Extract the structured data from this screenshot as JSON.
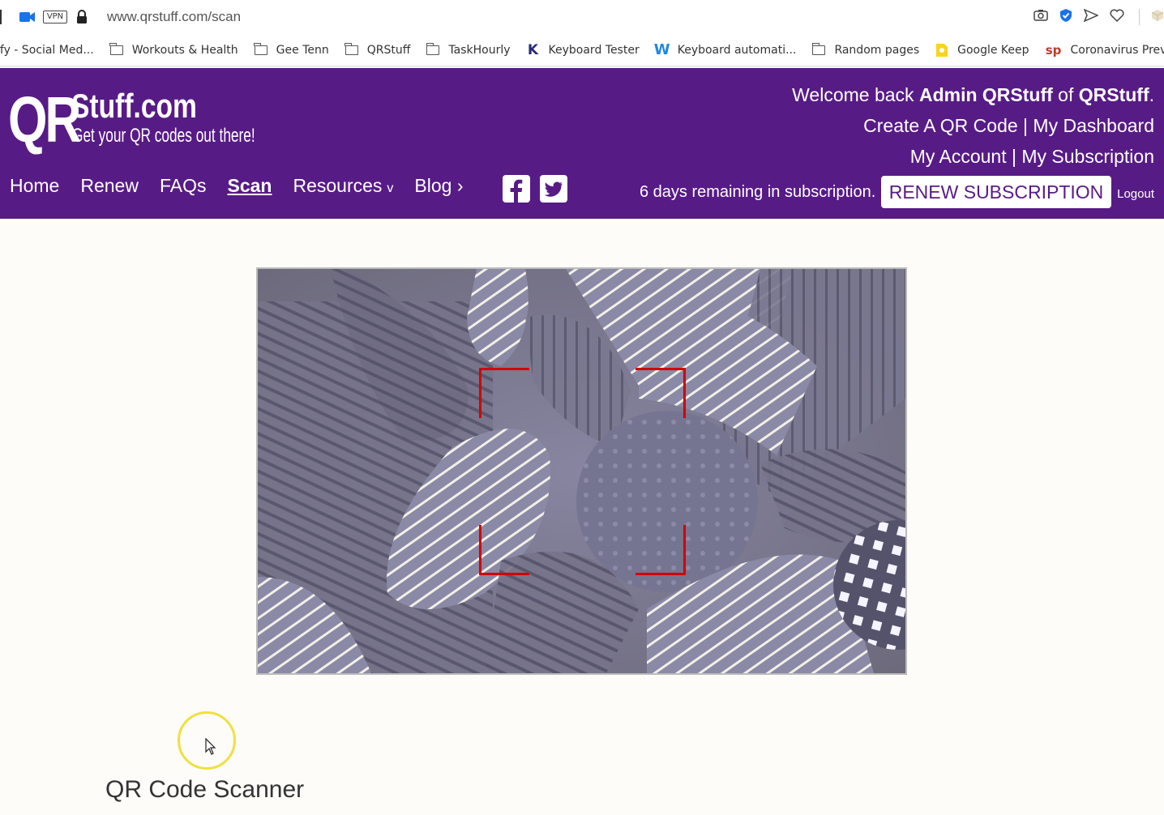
{
  "browser": {
    "vpn_label": "VPN",
    "url": "www.qrstuff.com/scan",
    "bookmarks": [
      {
        "label": "ify - Social Med...",
        "icon": "none"
      },
      {
        "label": "Workouts & Health",
        "icon": "folder-icon"
      },
      {
        "label": "Gee Tenn",
        "icon": "folder-icon"
      },
      {
        "label": "QRStuff",
        "icon": "folder-icon"
      },
      {
        "label": "TaskHourly",
        "icon": "folder-icon"
      },
      {
        "label": "Keyboard Tester",
        "icon": "k-logo-icon"
      },
      {
        "label": "Keyboard automati...",
        "icon": "w-logo-icon"
      },
      {
        "label": "Random pages",
        "icon": "folder-icon"
      },
      {
        "label": "Google Keep",
        "icon": "keep-icon"
      },
      {
        "label": "Coronavirus Preven...",
        "icon": "sp-logo-icon"
      }
    ]
  },
  "header": {
    "logo_qr": "QR",
    "logo_name": "Stuff.com",
    "logo_tagline": "Get your QR codes out there!",
    "welcome_prefix": "Welcome back ",
    "user_name": "Admin QRStuff",
    "welcome_of": " of ",
    "org_name": "QRStuff",
    "welcome_suffix": ".",
    "create_link": "Create A QR Code",
    "dashboard_link": "My Dashboard",
    "account_link": "My Account",
    "subscription_link": "My Subscription",
    "separator": " | ",
    "days_remaining": "6 days remaining in subscription.",
    "renew_button": "RENEW SUBSCRIPTION",
    "logout": "Logout"
  },
  "nav": {
    "home": "Home",
    "renew": "Renew",
    "faqs": "FAQs",
    "scan": "Scan",
    "resources": "Resources",
    "resources_chevron": "v",
    "blog": "Blog ›"
  },
  "colors": {
    "brand_purple": "#571b86",
    "scan_frame_red": "#d40000",
    "cursor_highlight": "#f0e040"
  },
  "main": {
    "page_title": "QR Code Scanner"
  }
}
